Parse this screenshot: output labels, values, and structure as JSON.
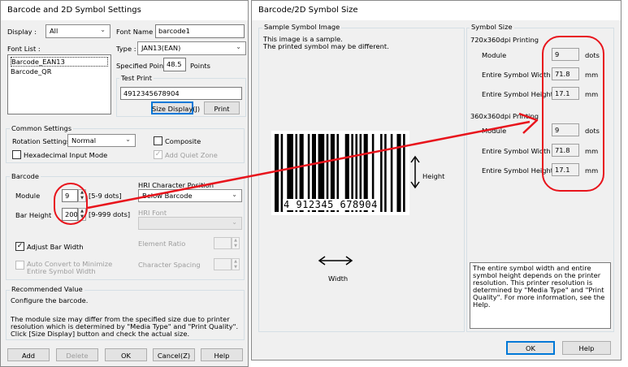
{
  "settings_dialog": {
    "title": "Barcode and 2D Symbol Settings",
    "display_label": "Display :",
    "display_value": "All",
    "font_list_label": "Font List :",
    "font_list_items": [
      "Barcode_EAN13",
      "Barcode_QR"
    ],
    "font_name_label": "Font Name :",
    "font_name_value": "barcode1",
    "type_label": "Type :",
    "type_value": "JAN13(EAN)",
    "specified_point_label": "Specified Point :",
    "specified_point_value": "48.5",
    "points_unit": "Points",
    "test_print_label": "Test Print",
    "test_print_value": "4912345678904",
    "size_display_button": "Size Display(J)",
    "print_button": "Print",
    "common_settings_label": "Common Settings",
    "rotation_label": "Rotation Settings",
    "rotation_value": "Normal",
    "composite_label": "Composite",
    "hex_input_label": "Hexadecimal Input Mode",
    "add_quiet_zone_label": "Add Quiet Zone",
    "barcode_group_label": "Barcode",
    "module_label": "Module",
    "module_value": "9",
    "module_range": "[5-9 dots]",
    "bar_height_label": "Bar Height",
    "bar_height_value": "200",
    "bar_height_range": "[9-999 dots]",
    "hri_position_label": "HRI Character Position",
    "hri_position_value": "Below Barcode",
    "hri_font_label": "HRI Font",
    "element_ratio_label": "Element Ratio",
    "adjust_bar_width_label": "Adjust Bar Width",
    "auto_convert_label": "Auto Convert to Minimize Entire Symbol Width",
    "char_spacing_label": "Character Spacing",
    "recommended_label": "Recommended Value",
    "recommended_text": "Configure the barcode.",
    "note_text": "The module size may differ from the specified size due to printer resolution which is determined by \"Media Type\" and \"Print Quality\". Click [Size Display] button and check the actual size.",
    "add_button": "Add",
    "delete_button": "Delete",
    "ok_button": "OK",
    "cancel_button": "Cancel(Z)",
    "help_button": "Help"
  },
  "size_dialog": {
    "title": "Barcode/2D Symbol Size",
    "sample_group_label": "Sample Symbol Image",
    "sample_note": "This image is a sample.\nThe printed symbol may be different.",
    "barcode_digits": "4 912345 678904",
    "height_label": "Height",
    "width_label": "Width",
    "symbol_size_label": "Symbol Size",
    "res1_label": "720x360dpi Printing",
    "res1_module_label": "Module",
    "res1_module_value": "9",
    "res1_module_unit": "dots",
    "res1_width_label": "Entire Symbol Width",
    "res1_width_value": "71.8",
    "res1_width_unit": "mm",
    "res1_height_label": "Entire Symbol Height",
    "res1_height_value": "17.1",
    "res1_height_unit": "mm",
    "res2_label": "360x360dpi Printing",
    "res2_module_label": "Module",
    "res2_module_value": "9",
    "res2_module_unit": "dots",
    "res2_width_label": "Entire Symbol Width",
    "res2_width_value": "71.8",
    "res2_width_unit": "mm",
    "res2_height_label": "Entire Symbol Height",
    "res2_height_value": "17.1",
    "res2_height_unit": "mm",
    "info_text": "The entire symbol width and entire symbol height depends on the printer resolution. This printer resolution is determined by \"Media Type\" and \"Print Quality\". For more information, see the Help.",
    "ok_button": "OK",
    "help_button": "Help"
  },
  "annotation_color": "#e8141c"
}
